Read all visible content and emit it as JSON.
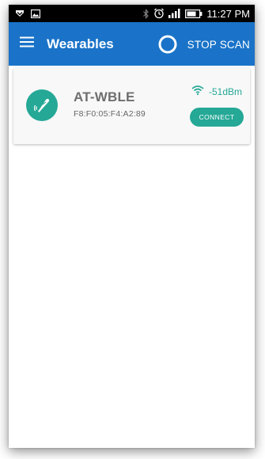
{
  "status_bar": {
    "time": "11:27 PM",
    "icons": [
      "notification-icon",
      "image-icon",
      "bluetooth-icon",
      "alarm-icon",
      "signal-icon",
      "battery-icon"
    ]
  },
  "app_bar": {
    "title": "Wearables",
    "action_label": "STOP SCAN",
    "color": "#1a73c8"
  },
  "devices": [
    {
      "name": "AT-WBLE",
      "address": "F8:F0:05:F4:A2:89",
      "rssi": "-51dBm",
      "connect_label": "CONNECT",
      "icon": "wearable-icon",
      "accent": "#25a896"
    }
  ]
}
